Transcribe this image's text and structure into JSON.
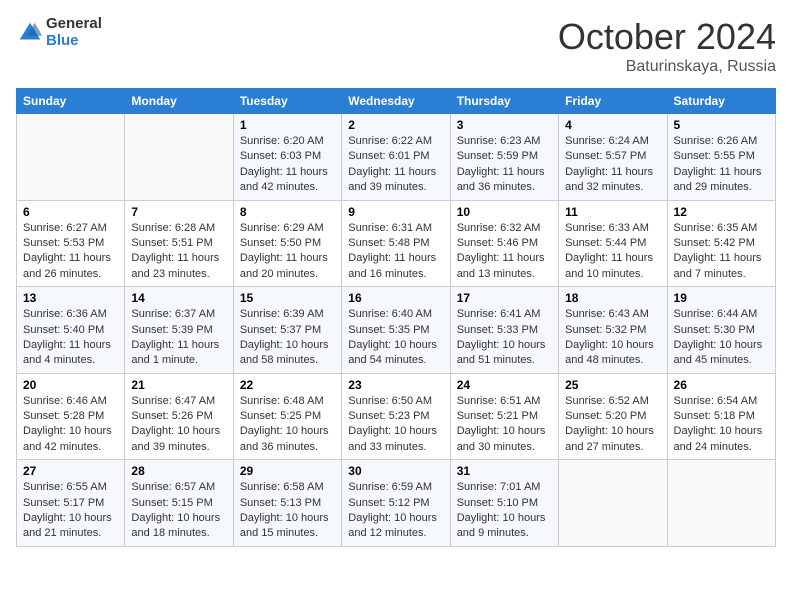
{
  "header": {
    "logo_general": "General",
    "logo_blue": "Blue",
    "month_title": "October 2024",
    "location": "Baturinskaya, Russia"
  },
  "weekdays": [
    "Sunday",
    "Monday",
    "Tuesday",
    "Wednesday",
    "Thursday",
    "Friday",
    "Saturday"
  ],
  "weeks": [
    [
      {
        "day": "",
        "sunrise": "",
        "sunset": "",
        "daylight": ""
      },
      {
        "day": "",
        "sunrise": "",
        "sunset": "",
        "daylight": ""
      },
      {
        "day": "1",
        "sunrise": "Sunrise: 6:20 AM",
        "sunset": "Sunset: 6:03 PM",
        "daylight": "Daylight: 11 hours and 42 minutes."
      },
      {
        "day": "2",
        "sunrise": "Sunrise: 6:22 AM",
        "sunset": "Sunset: 6:01 PM",
        "daylight": "Daylight: 11 hours and 39 minutes."
      },
      {
        "day": "3",
        "sunrise": "Sunrise: 6:23 AM",
        "sunset": "Sunset: 5:59 PM",
        "daylight": "Daylight: 11 hours and 36 minutes."
      },
      {
        "day": "4",
        "sunrise": "Sunrise: 6:24 AM",
        "sunset": "Sunset: 5:57 PM",
        "daylight": "Daylight: 11 hours and 32 minutes."
      },
      {
        "day": "5",
        "sunrise": "Sunrise: 6:26 AM",
        "sunset": "Sunset: 5:55 PM",
        "daylight": "Daylight: 11 hours and 29 minutes."
      }
    ],
    [
      {
        "day": "6",
        "sunrise": "Sunrise: 6:27 AM",
        "sunset": "Sunset: 5:53 PM",
        "daylight": "Daylight: 11 hours and 26 minutes."
      },
      {
        "day": "7",
        "sunrise": "Sunrise: 6:28 AM",
        "sunset": "Sunset: 5:51 PM",
        "daylight": "Daylight: 11 hours and 23 minutes."
      },
      {
        "day": "8",
        "sunrise": "Sunrise: 6:29 AM",
        "sunset": "Sunset: 5:50 PM",
        "daylight": "Daylight: 11 hours and 20 minutes."
      },
      {
        "day": "9",
        "sunrise": "Sunrise: 6:31 AM",
        "sunset": "Sunset: 5:48 PM",
        "daylight": "Daylight: 11 hours and 16 minutes."
      },
      {
        "day": "10",
        "sunrise": "Sunrise: 6:32 AM",
        "sunset": "Sunset: 5:46 PM",
        "daylight": "Daylight: 11 hours and 13 minutes."
      },
      {
        "day": "11",
        "sunrise": "Sunrise: 6:33 AM",
        "sunset": "Sunset: 5:44 PM",
        "daylight": "Daylight: 11 hours and 10 minutes."
      },
      {
        "day": "12",
        "sunrise": "Sunrise: 6:35 AM",
        "sunset": "Sunset: 5:42 PM",
        "daylight": "Daylight: 11 hours and 7 minutes."
      }
    ],
    [
      {
        "day": "13",
        "sunrise": "Sunrise: 6:36 AM",
        "sunset": "Sunset: 5:40 PM",
        "daylight": "Daylight: 11 hours and 4 minutes."
      },
      {
        "day": "14",
        "sunrise": "Sunrise: 6:37 AM",
        "sunset": "Sunset: 5:39 PM",
        "daylight": "Daylight: 11 hours and 1 minute."
      },
      {
        "day": "15",
        "sunrise": "Sunrise: 6:39 AM",
        "sunset": "Sunset: 5:37 PM",
        "daylight": "Daylight: 10 hours and 58 minutes."
      },
      {
        "day": "16",
        "sunrise": "Sunrise: 6:40 AM",
        "sunset": "Sunset: 5:35 PM",
        "daylight": "Daylight: 10 hours and 54 minutes."
      },
      {
        "day": "17",
        "sunrise": "Sunrise: 6:41 AM",
        "sunset": "Sunset: 5:33 PM",
        "daylight": "Daylight: 10 hours and 51 minutes."
      },
      {
        "day": "18",
        "sunrise": "Sunrise: 6:43 AM",
        "sunset": "Sunset: 5:32 PM",
        "daylight": "Daylight: 10 hours and 48 minutes."
      },
      {
        "day": "19",
        "sunrise": "Sunrise: 6:44 AM",
        "sunset": "Sunset: 5:30 PM",
        "daylight": "Daylight: 10 hours and 45 minutes."
      }
    ],
    [
      {
        "day": "20",
        "sunrise": "Sunrise: 6:46 AM",
        "sunset": "Sunset: 5:28 PM",
        "daylight": "Daylight: 10 hours and 42 minutes."
      },
      {
        "day": "21",
        "sunrise": "Sunrise: 6:47 AM",
        "sunset": "Sunset: 5:26 PM",
        "daylight": "Daylight: 10 hours and 39 minutes."
      },
      {
        "day": "22",
        "sunrise": "Sunrise: 6:48 AM",
        "sunset": "Sunset: 5:25 PM",
        "daylight": "Daylight: 10 hours and 36 minutes."
      },
      {
        "day": "23",
        "sunrise": "Sunrise: 6:50 AM",
        "sunset": "Sunset: 5:23 PM",
        "daylight": "Daylight: 10 hours and 33 minutes."
      },
      {
        "day": "24",
        "sunrise": "Sunrise: 6:51 AM",
        "sunset": "Sunset: 5:21 PM",
        "daylight": "Daylight: 10 hours and 30 minutes."
      },
      {
        "day": "25",
        "sunrise": "Sunrise: 6:52 AM",
        "sunset": "Sunset: 5:20 PM",
        "daylight": "Daylight: 10 hours and 27 minutes."
      },
      {
        "day": "26",
        "sunrise": "Sunrise: 6:54 AM",
        "sunset": "Sunset: 5:18 PM",
        "daylight": "Daylight: 10 hours and 24 minutes."
      }
    ],
    [
      {
        "day": "27",
        "sunrise": "Sunrise: 6:55 AM",
        "sunset": "Sunset: 5:17 PM",
        "daylight": "Daylight: 10 hours and 21 minutes."
      },
      {
        "day": "28",
        "sunrise": "Sunrise: 6:57 AM",
        "sunset": "Sunset: 5:15 PM",
        "daylight": "Daylight: 10 hours and 18 minutes."
      },
      {
        "day": "29",
        "sunrise": "Sunrise: 6:58 AM",
        "sunset": "Sunset: 5:13 PM",
        "daylight": "Daylight: 10 hours and 15 minutes."
      },
      {
        "day": "30",
        "sunrise": "Sunrise: 6:59 AM",
        "sunset": "Sunset: 5:12 PM",
        "daylight": "Daylight: 10 hours and 12 minutes."
      },
      {
        "day": "31",
        "sunrise": "Sunrise: 7:01 AM",
        "sunset": "Sunset: 5:10 PM",
        "daylight": "Daylight: 10 hours and 9 minutes."
      },
      {
        "day": "",
        "sunrise": "",
        "sunset": "",
        "daylight": ""
      },
      {
        "day": "",
        "sunrise": "",
        "sunset": "",
        "daylight": ""
      }
    ]
  ]
}
